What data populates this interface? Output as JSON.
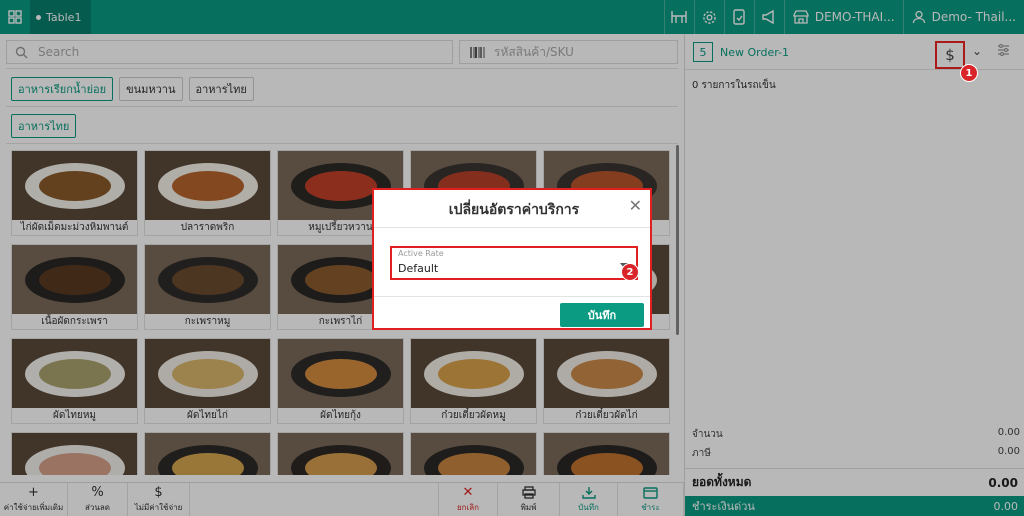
{
  "topbar": {
    "table_tab": "Table1",
    "store_name": "DEMO-THAI...",
    "user_name": "Demo- Thail..."
  },
  "search": {
    "placeholder": "Search",
    "sku_placeholder": "รหัสสินค้า/SKU"
  },
  "categories": [
    "อาหารเรียกน้ำย่อย",
    "ขนมหวาน",
    "อาหารไทย"
  ],
  "subcategory": "อาหารไทย",
  "products": [
    {
      "name": "ไก่ผัดเม็ดมะม่วงหิมพานต์",
      "plate": "#f4f1ea",
      "food": "#8a5a2b"
    },
    {
      "name": "ปลาราดพริก",
      "plate": "#f6f2e9",
      "food": "#b8652e"
    },
    {
      "name": "หมูเปรี้ยวหวาน",
      "plate": "#2d2a26",
      "food": "#c2412a"
    },
    {
      "name": "",
      "plate": "#3a3430",
      "food": "#b7402a"
    },
    {
      "name": "",
      "plate": "#3a3430",
      "food": "#b9552d"
    },
    {
      "name": "เนื้อผัดกระเพรา",
      "plate": "#2a2725",
      "food": "#5a3a22"
    },
    {
      "name": "กะเพราหมู",
      "plate": "#2e2c2a",
      "food": "#6a4a2e"
    },
    {
      "name": "กะเพราไก่",
      "plate": "#2a2826",
      "food": "#8b5a2e"
    },
    {
      "name": "",
      "plate": "#e9e4da",
      "food": "#d8d2c6"
    },
    {
      "name": "",
      "plate": "#f0ece4",
      "food": "#e6e1d8"
    },
    {
      "name": "ผัดไทยหมู",
      "plate": "#f5f3ee",
      "food": "#a9a36d"
    },
    {
      "name": "ผัดไทยไก่",
      "plate": "#f2eee6",
      "food": "#d9b56a"
    },
    {
      "name": "ผัดไทยกุ้ง",
      "plate": "#2f2c29",
      "food": "#d58d3f"
    },
    {
      "name": "ก๋วยเตี๋ยวผัดหมู",
      "plate": "#f3efe7",
      "food": "#d9a24c"
    },
    {
      "name": "ก๋วยเตี๋ยวผัดไก่",
      "plate": "#f1ede6",
      "food": "#c98a4a"
    },
    {
      "name": "",
      "plate": "#f3f0ea",
      "food": "#d6a08a"
    },
    {
      "name": "",
      "plate": "#2d2a27",
      "food": "#d4a550"
    },
    {
      "name": "",
      "plate": "#2b2825",
      "food": "#d49b4e"
    },
    {
      "name": "",
      "plate": "#2c2926",
      "food": "#c78540"
    },
    {
      "name": "",
      "plate": "#2a2724",
      "food": "#c0722f"
    }
  ],
  "bottom_bar": {
    "extra_charge": "ค่าใช้จ่ายเพิ่มเติม",
    "discount": "ส่วนลด",
    "no_charge": "ไม่มีค่าใช้จ่าย",
    "cancel": "ยกเลิก",
    "print": "พิมพ์",
    "save": "บันทึก",
    "pay": "ชำระ"
  },
  "order": {
    "number": "5",
    "name": "New Order-1",
    "items_in_cart": "0 รายการในรถเข็น",
    "quantity_label": "จำนวน",
    "quantity_value": "0.00",
    "tax_label": "ภาษี",
    "tax_value": "0.00",
    "total_label": "ยอดทั้งหมด",
    "total_value": "0.00",
    "pay_label": "ชำระเงินด่วน",
    "pay_value": "0.00"
  },
  "modal": {
    "title": "เปลี่ยนอัตราค่าบริการ",
    "field_label": "Active Rate",
    "field_value": "Default",
    "save_label": "บันทึก"
  },
  "badges": {
    "one": "1",
    "two": "2"
  },
  "colors": {
    "accent": "#0b9a82",
    "highlight": "#e02020"
  }
}
